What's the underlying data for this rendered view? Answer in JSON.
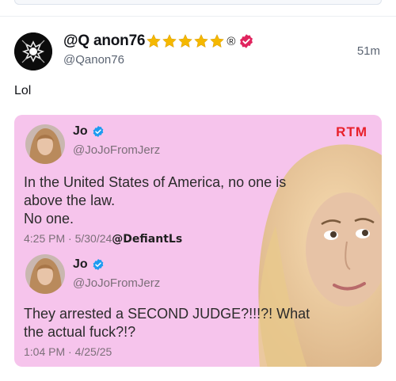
{
  "post": {
    "display_name": "@Q anon76",
    "handle": "@Qanon76",
    "timestamp": "51m",
    "registered_mark": "®",
    "text": "Lol"
  },
  "media": {
    "watermark": "RTM",
    "tweets": [
      {
        "name": "Jo",
        "handle": "@JoJoFromJerz",
        "lines": [
          "In the United States of America, no one is",
          "above the law.",
          "No one."
        ],
        "meta": "4:25 PM · 5/30/24",
        "tag": "@DefiantLs"
      },
      {
        "name": "Jo",
        "handle": "@JoJoFromJerz",
        "lines": [
          "They arrested a SECOND JUDGE?!!!?! What",
          "the actual fuck?!?"
        ],
        "meta": "1:04 PM · 4/25/25",
        "tag": ""
      }
    ]
  },
  "colors": {
    "verified_badge": "#e0245e",
    "tweet_check": "#1d9bf0",
    "media_bg": "#f6c4ec",
    "star": "#f5b800",
    "watermark": "#e8212b"
  },
  "icons": {
    "stars": [
      "star-icon",
      "star-icon",
      "star-icon",
      "star-icon",
      "star-icon"
    ],
    "badge": "verified-badge-icon"
  }
}
